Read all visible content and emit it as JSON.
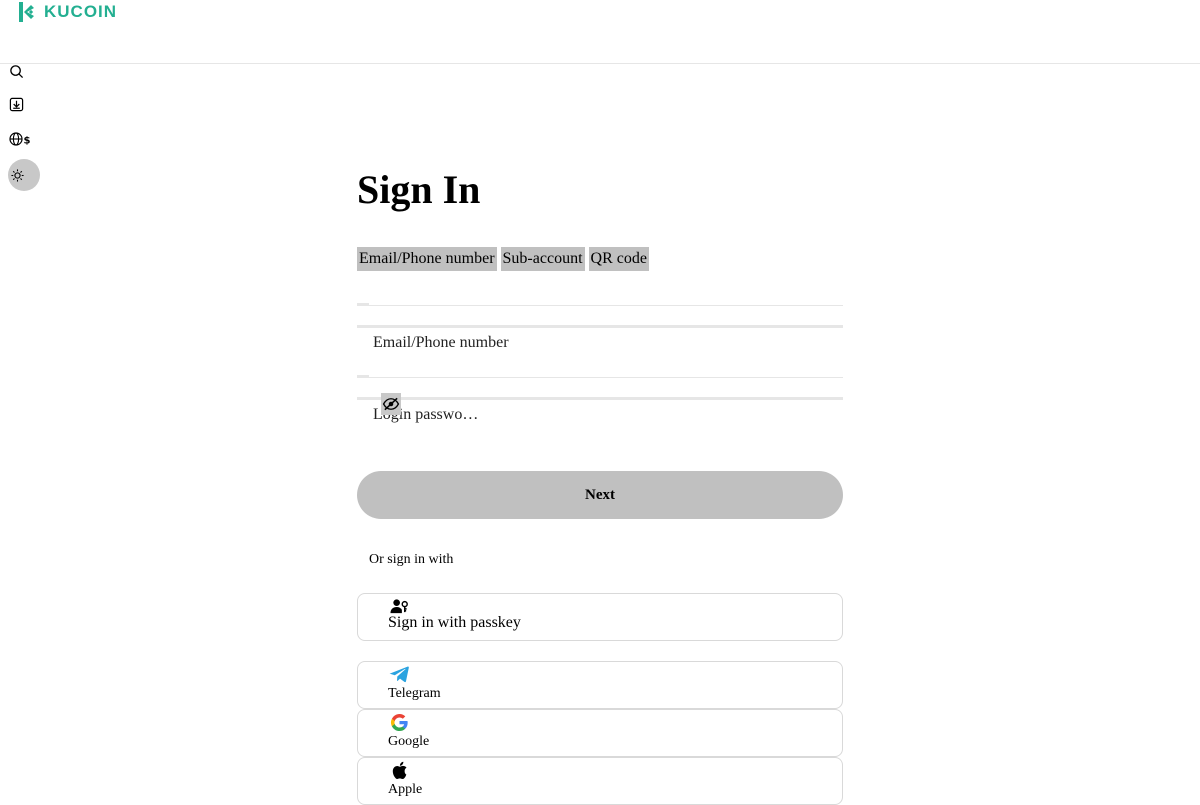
{
  "brand": {
    "name": "KUCOIN",
    "color": "#23af91"
  },
  "sidebar_icons": [
    "search-icon",
    "download-icon",
    "language-currency-icon",
    "theme-toggle-icon"
  ],
  "page": {
    "title": "Sign In"
  },
  "tabs": [
    {
      "label": "Email/Phone number",
      "active": true
    },
    {
      "label": "Sub-account",
      "active": false
    },
    {
      "label": "QR code",
      "active": false
    }
  ],
  "form": {
    "email_placeholder": "Email/Phone number",
    "password_placeholder": "Login passwo…",
    "next_label": "Next"
  },
  "alt_signin": {
    "divider_text": "Or sign in with",
    "options": [
      {
        "label": "Sign in with passkey",
        "icon": "passkey-icon"
      },
      {
        "label": "Telegram",
        "icon": "telegram-icon",
        "color": "#2aa3e0"
      },
      {
        "label": "Google",
        "icon": "google-icon"
      },
      {
        "label": "Apple",
        "icon": "apple-icon"
      }
    ]
  }
}
